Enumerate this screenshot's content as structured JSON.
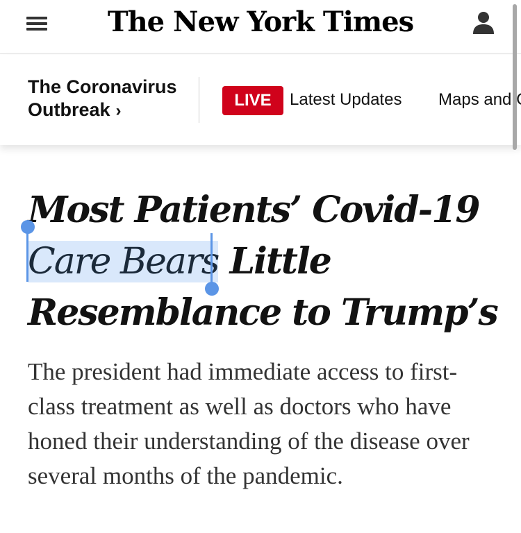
{
  "masthead": {
    "logo_text": "The New York Times",
    "menu_icon": "hamburger-menu-icon",
    "account_icon": "user-account-icon"
  },
  "subnav": {
    "section_line1": "The Coronavirus",
    "section_line2": "Outbreak",
    "chevron": "›",
    "live_label": "LIVE",
    "latest_updates": "Latest Updates",
    "maps_link": "Maps and C"
  },
  "article": {
    "headline": {
      "line1": "Most Patients’ Covid-19",
      "selected_text": "Care Bears",
      "line2_rest": " Little",
      "line3": "Resemblance to Trump’s"
    },
    "summary": "The president had immediate access to first-class treatment as well as doctors who have honed their understanding of the disease over several months of the pandemic."
  },
  "colors": {
    "live_red": "#d0021b",
    "selection_blue": "#5b95e6",
    "selection_highlight": "#d9e8fb"
  }
}
